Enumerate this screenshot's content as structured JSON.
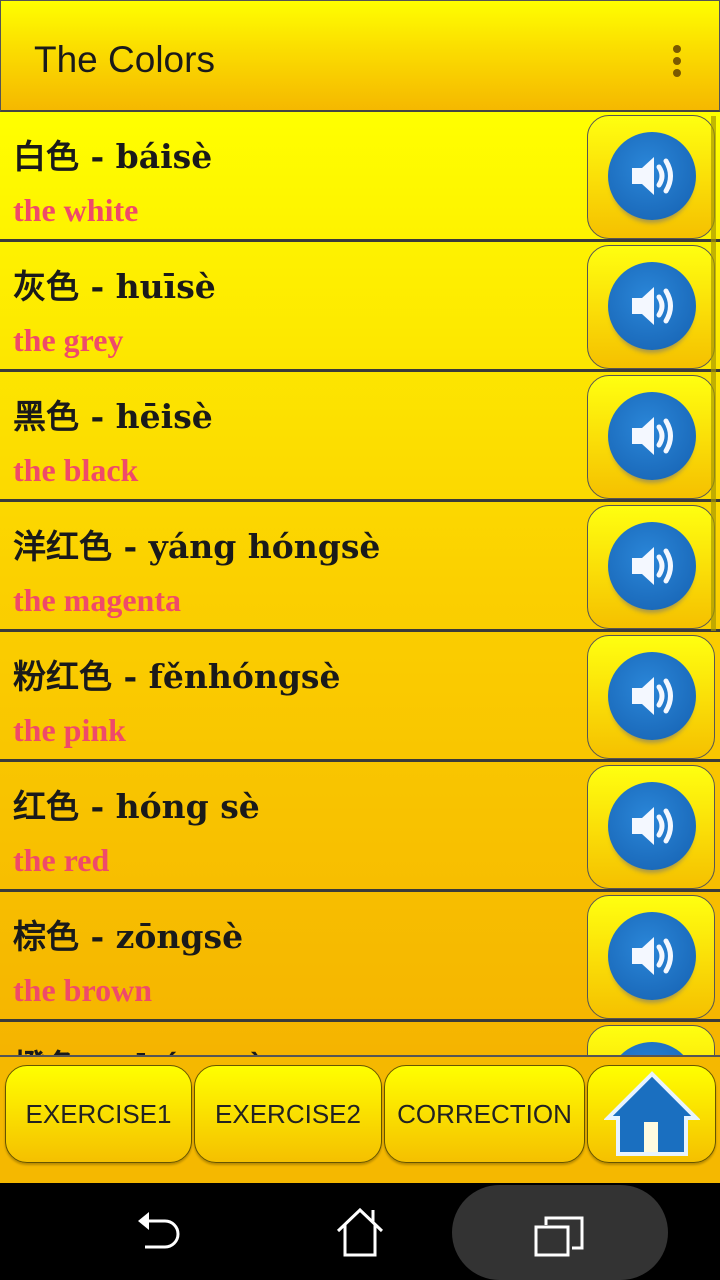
{
  "appbar": {
    "title": "The Colors",
    "menu_icon": "overflow-menu-icon"
  },
  "items": [
    {
      "chinese": "白色 - báisè",
      "english": "the white"
    },
    {
      "chinese": "灰色 - huīsè",
      "english": "the grey"
    },
    {
      "chinese": "黑色 - hēisè",
      "english": "the black"
    },
    {
      "chinese": "洋红色 - yáng hóngsè",
      "english": "the magenta"
    },
    {
      "chinese": "粉红色 - fěnhóngsè",
      "english": "the pink"
    },
    {
      "chinese": "红色 - hóng sè",
      "english": "the red"
    },
    {
      "chinese": "棕色 - zōngsè",
      "english": "the brown"
    },
    {
      "chinese": "橙色 - chéngsè",
      "english": ""
    }
  ],
  "bottom": {
    "exercise1": "EXERCISE1",
    "exercise2": "EXERCISE2",
    "correction": "CORRECTION"
  },
  "colors": {
    "accent_yellow": "#ffff00",
    "english_text": "#ef4a6a",
    "speaker_blue": "#1a6fc0"
  }
}
